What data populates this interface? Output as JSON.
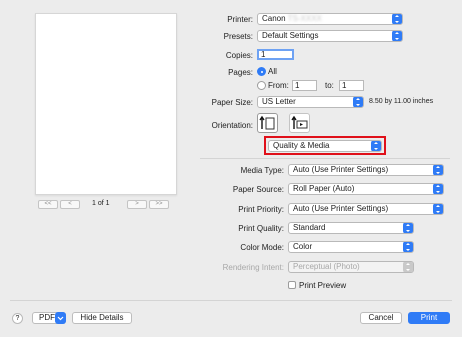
{
  "printer": {
    "label": "Printer:",
    "value": "Canon ",
    "model_redacted": "TS-XXXX"
  },
  "presets": {
    "label": "Presets:",
    "value": "Default Settings"
  },
  "copies": {
    "label": "Copies:",
    "value": "1"
  },
  "pages": {
    "label": "Pages:",
    "all_label": "All",
    "from_label": "From:",
    "from_value": "1",
    "to_label": "to:",
    "to_value": "1"
  },
  "paper_size": {
    "label": "Paper Size:",
    "value": "US Letter",
    "dimensions": "8.50 by 11.00 inches"
  },
  "orientation": {
    "label": "Orientation:"
  },
  "section_popup": {
    "value": "Quality & Media",
    "highlight_color": "#e0101a"
  },
  "media_type": {
    "label": "Media Type:",
    "value": "Auto (Use Printer Settings)"
  },
  "paper_source": {
    "label": "Paper Source:",
    "value": "Roll Paper (Auto)"
  },
  "print_priority": {
    "label": "Print Priority:",
    "value": "Auto (Use Printer Settings)"
  },
  "print_quality": {
    "label": "Print Quality:",
    "value": "Standard"
  },
  "color_mode": {
    "label": "Color Mode:",
    "value": "Color"
  },
  "rendering_intent": {
    "label": "Rendering Intent:",
    "value": "Perceptual (Photo)"
  },
  "print_preview": {
    "label": "Print Preview"
  },
  "preview_nav": {
    "first": "<<",
    "prev": "<",
    "page_indicator": "1 of 1",
    "next": ">",
    "last": ">>"
  },
  "footer": {
    "help": "?",
    "pdf": "PDF",
    "hide_details": "Hide Details",
    "cancel": "Cancel",
    "print": "Print"
  },
  "colors": {
    "accent": "#2f7bf6",
    "background": "#ececec"
  }
}
